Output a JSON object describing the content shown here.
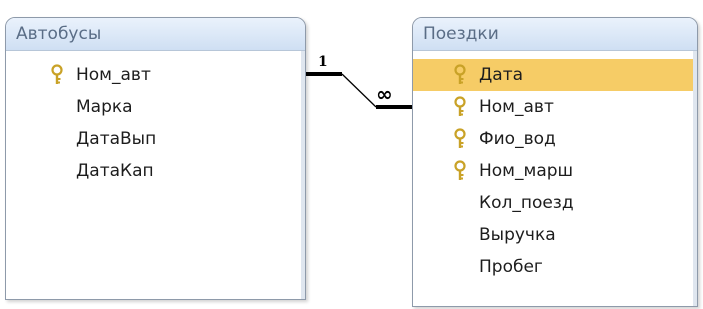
{
  "tables": {
    "left": {
      "title": "Автобусы",
      "fields": [
        {
          "name": "Ном_авт",
          "key": true
        },
        {
          "name": "Марка",
          "key": false
        },
        {
          "name": "ДатаВып",
          "key": false
        },
        {
          "name": "ДатаКап",
          "key": false
        }
      ]
    },
    "right": {
      "title": "Поездки",
      "fields": [
        {
          "name": "Дата",
          "key": true,
          "selected": true
        },
        {
          "name": "Ном_авт",
          "key": true
        },
        {
          "name": "Фио_вод",
          "key": true
        },
        {
          "name": "Ном_марш",
          "key": true
        },
        {
          "name": "Кол_поезд",
          "key": false
        },
        {
          "name": "Выручка",
          "key": false
        },
        {
          "name": "Пробег",
          "key": false
        }
      ]
    }
  },
  "relationship": {
    "one_label": "1",
    "many_label": "∞"
  },
  "colors": {
    "header_text": "#5a6d86",
    "selected_row": "#f6cc66",
    "key_icon": "#c9a227",
    "border": "#8e9aaa"
  },
  "icons": {
    "key": "key-icon"
  }
}
